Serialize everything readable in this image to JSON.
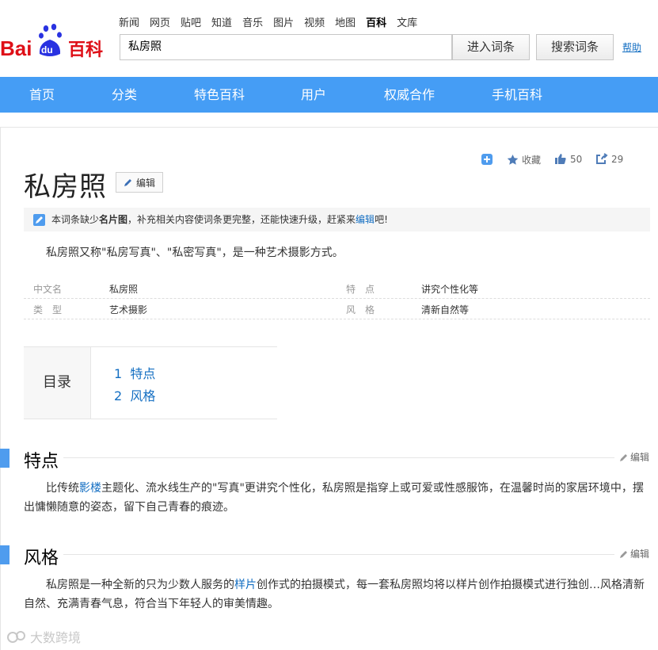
{
  "topnav": {
    "items": [
      "新闻",
      "网页",
      "贴吧",
      "知道",
      "音乐",
      "图片",
      "视频",
      "地图",
      "百科",
      "文库"
    ],
    "active": "百科"
  },
  "logo": {
    "text_a": "Bai",
    "text_du": "du",
    "text_cn": "百科"
  },
  "search": {
    "value": "私房照",
    "enter_label": "进入词条",
    "search_label": "搜索词条",
    "help_label": "帮助"
  },
  "mainnav": [
    "首页",
    "分类",
    "特色百科",
    "用户",
    "权威合作",
    "手机百科"
  ],
  "toolbar": {
    "collect_label": "收藏",
    "like_count": "50",
    "share_count": "29"
  },
  "entry": {
    "title": "私房照",
    "edit_label": "编辑",
    "notice": {
      "prefix": "本词条缺少",
      "bold": "名片图",
      "middle": "，补充相关内容使词条更完整，还能快速升级，赶紧来",
      "link": "编辑",
      "suffix": "吧!"
    },
    "summary": "私房照又称\"私房写真\"、\"私密写真\"，是一种艺术摄影方式。",
    "basic_info": [
      {
        "left_key": "中文名",
        "left_val": "私房照",
        "right_key": "特　点",
        "right_val": "讲究个性化等"
      },
      {
        "left_key": "类　型",
        "left_val": "艺术摄影",
        "right_key": "风　格",
        "right_val": "清新自然等"
      }
    ],
    "toc": {
      "label": "目录",
      "items": [
        {
          "num": "1",
          "text": "特点"
        },
        {
          "num": "2",
          "text": "风格"
        }
      ]
    },
    "sections": [
      {
        "title": "特点",
        "edit_label": "编辑",
        "text_a": "比传统",
        "link": "影楼",
        "text_b": "主题化、流水线生产的\"写真\"更讲究个性化，私房照是指穿上或可爱或性感服饰，在温馨时尚的家居环境中，摆出慵懒随意的姿态，留下自己青春的痕迹。"
      },
      {
        "title": "风格",
        "edit_label": "编辑",
        "text_a": "私房照是一种全新的只为少数人服务的",
        "link": "样片",
        "text_b": "创作式的拍摄模式，每一套私房照均将以样片创作拍摄模式进行独创…风格清新自然、充满青春气息，符合当下年轻人的审美情趣。"
      }
    ]
  },
  "watermark": "大数跨境",
  "colors": {
    "nav_blue": "#459df5",
    "link_blue": "#136ec2",
    "logo_red": "#de0f17",
    "logo_blue": "#2932e1",
    "section_bar": "#4f9cee"
  }
}
